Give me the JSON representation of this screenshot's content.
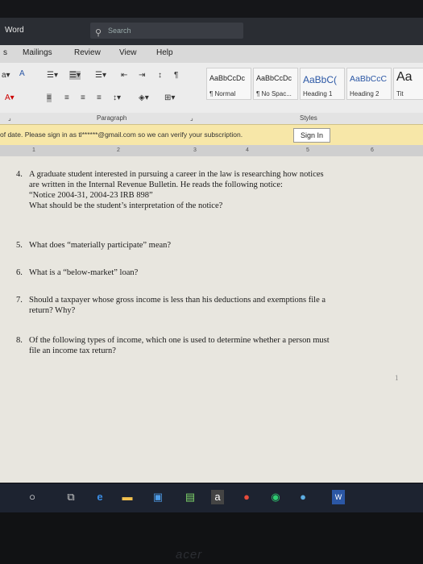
{
  "titlebar": {
    "app": "Word",
    "search_placeholder": "Search"
  },
  "tabs": [
    "Mailings",
    "Review",
    "View",
    "Help"
  ],
  "tab_left_cut": "s",
  "styles": [
    {
      "sample": "AaBbCcDc",
      "name": "¶ Normal"
    },
    {
      "sample": "AaBbCcDc",
      "name": "¶ No Spac..."
    },
    {
      "sample": "AaBbC(",
      "name": "Heading 1"
    },
    {
      "sample": "AaBbCcC",
      "name": "Heading 2"
    },
    {
      "sample": "Aa",
      "name": "Tit"
    }
  ],
  "groups": {
    "paragraph": "Paragraph",
    "styles": "Styles"
  },
  "message_bar": {
    "text": "of date. Please sign in as tl******@gmail.com so we can verify your subscription.",
    "button": "Sign In"
  },
  "ruler_ticks": [
    "1",
    "2",
    "3",
    "4",
    "5",
    "6"
  ],
  "questions": [
    {
      "num": "4.",
      "lines": [
        "A graduate student interested in pursuing a career in the law is researching how notices",
        "are written in the Internal Revenue Bulletin. He reads the following notice:",
        "“Notice 2004-31, 2004-23 IRB 898”",
        "What should be the student’s interpretation of the notice?"
      ]
    },
    {
      "num": "5.",
      "lines": [
        "What does “materially participate” mean?"
      ]
    },
    {
      "num": "6.",
      "lines": [
        "What is a “below-market” loan?"
      ]
    },
    {
      "num": "7.",
      "lines": [
        "Should a taxpayer whose gross income is less than his deductions and exemptions file a",
        "return? Why?"
      ]
    },
    {
      "num": "8.",
      "lines": [
        "Of the following types of income, which one is used to determine whether a person must",
        "file an income tax return?"
      ]
    }
  ],
  "page_number": "1",
  "brand": "acer",
  "colors": {
    "ribbon": "#ececec",
    "message_bar": "#f7e7a8",
    "document": "#e8e6df",
    "taskbar": "#1d2330"
  }
}
